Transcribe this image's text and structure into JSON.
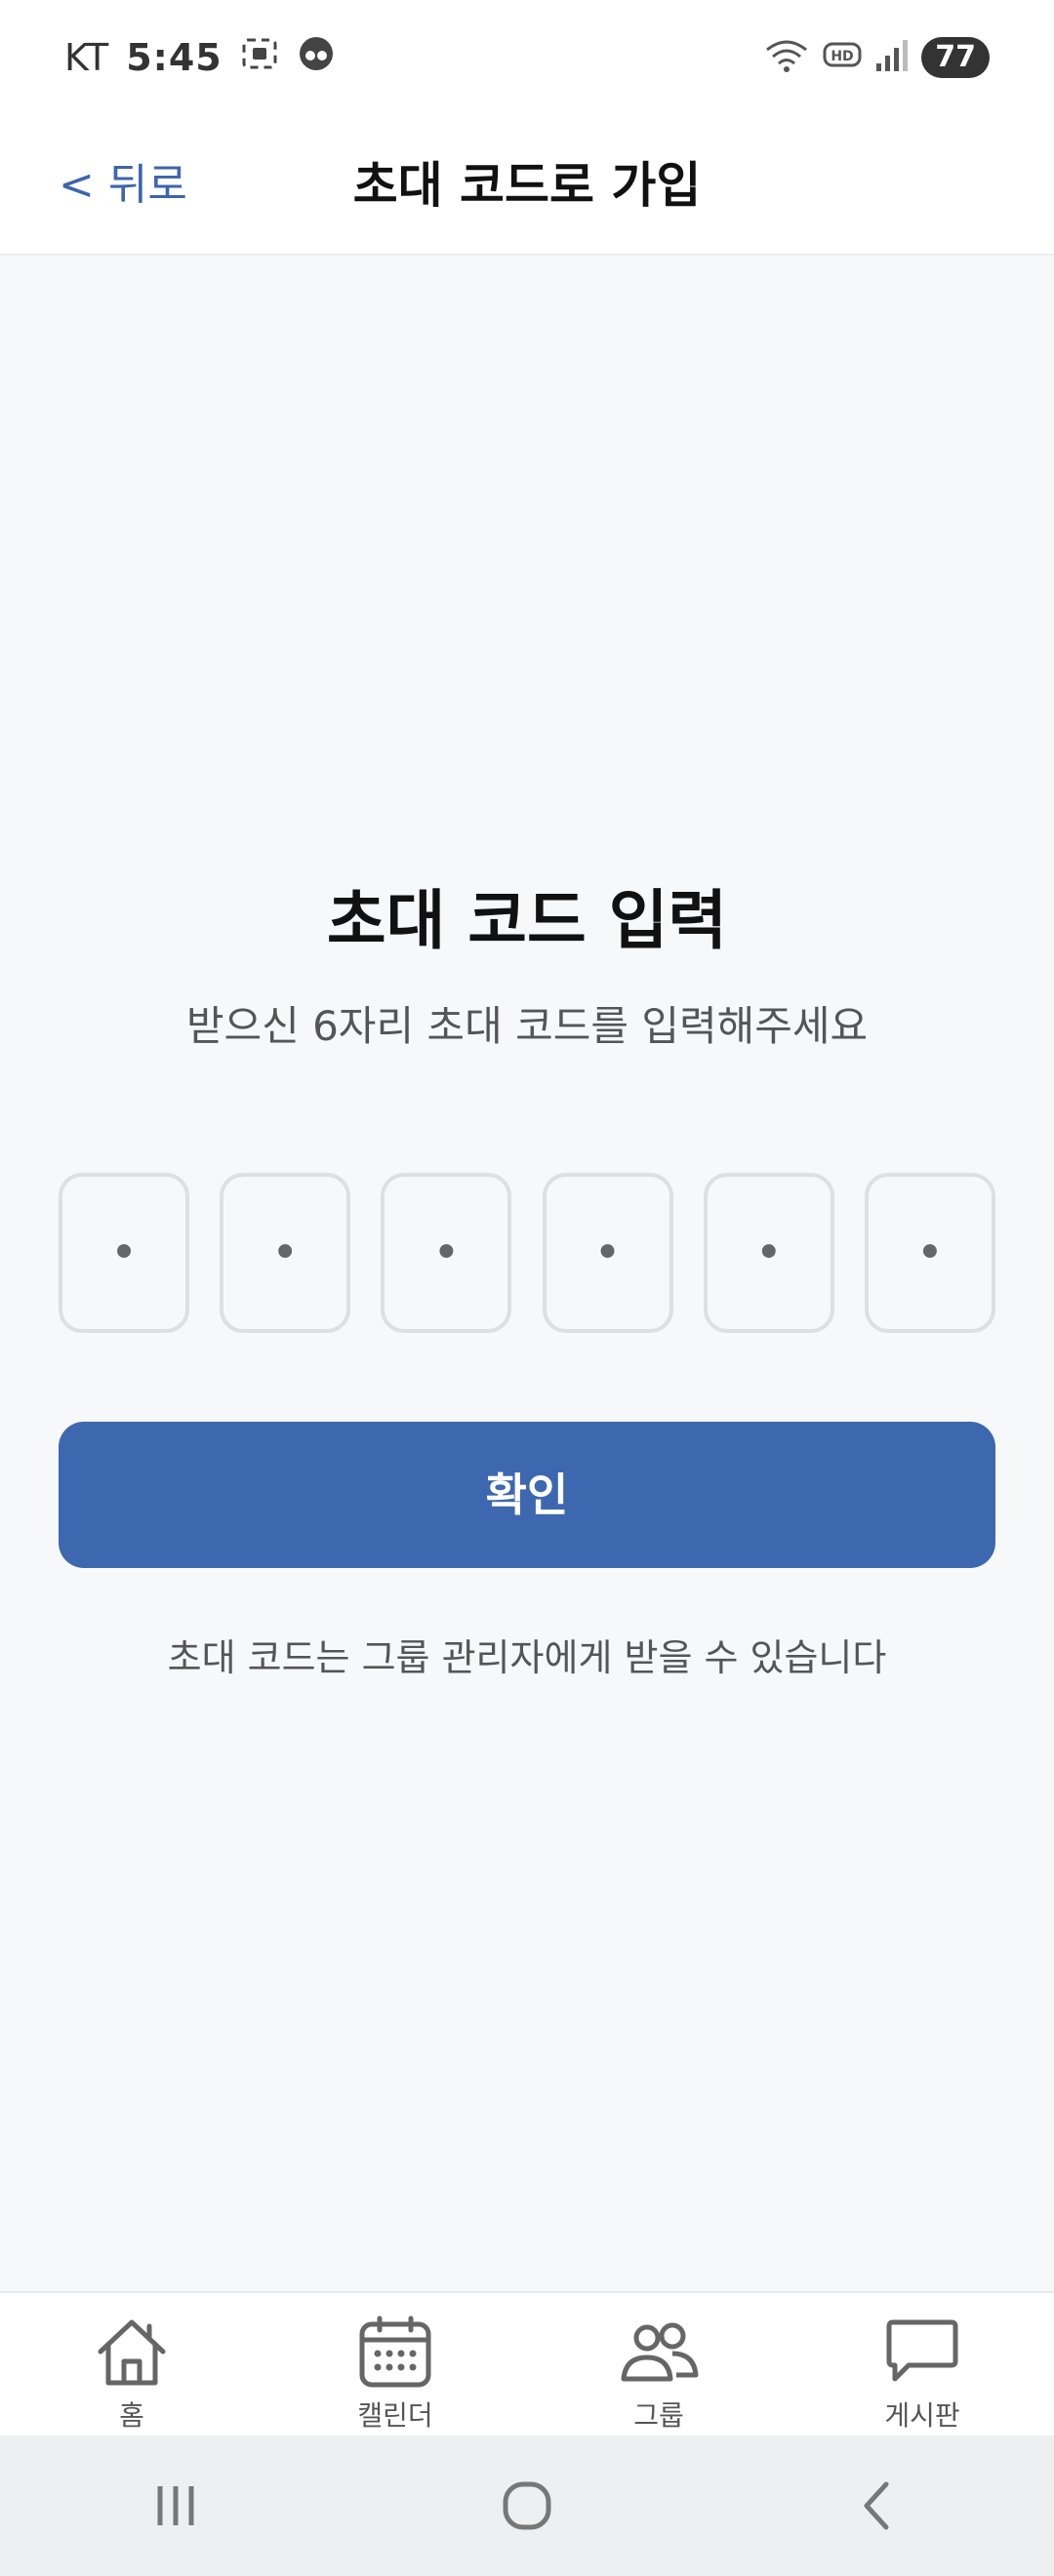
{
  "status_bar": {
    "carrier": "KT",
    "time": "5:45",
    "battery": "77"
  },
  "header": {
    "back_label": "< 뒤로",
    "title": "초대 코드로 가입"
  },
  "main": {
    "heading": "초대 코드 입력",
    "subtitle": "받으신 6자리 초대 코드를 입력해주세요",
    "code_placeholder": "•",
    "confirm_label": "확인",
    "helper_text": "초대 코드는 그룹 관리자에게 받을 수 있습니다"
  },
  "bottom_nav": {
    "items": [
      {
        "label": "홈",
        "icon": "home-icon"
      },
      {
        "label": "캘린더",
        "icon": "calendar-icon"
      },
      {
        "label": "그룹",
        "icon": "group-icon"
      },
      {
        "label": "게시판",
        "icon": "chat-bubble-icon"
      }
    ]
  },
  "colors": {
    "accent": "#3d68b0",
    "background": "#f7f8fa"
  }
}
